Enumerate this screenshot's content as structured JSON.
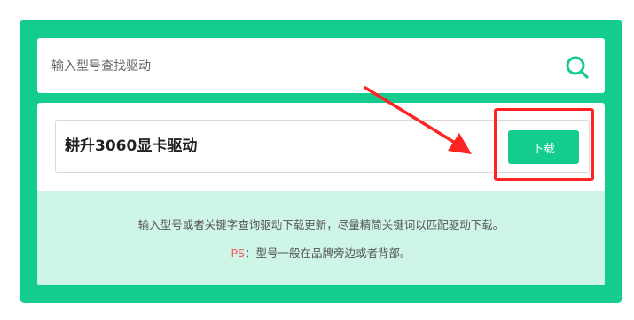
{
  "search": {
    "placeholder": "输入型号查找驱动",
    "value": "",
    "icon": "search-icon"
  },
  "result": {
    "title": "耕升3060显卡驱动",
    "download_label": "下载"
  },
  "hint": {
    "line1": "输入型号或者关键字查询驱动下载更新，尽量精简关键词以匹配驱动下载。",
    "ps_label": "PS",
    "ps_separator": "：",
    "ps_text": "型号一般在品牌旁边或者背部。"
  },
  "colors": {
    "brand_green": "#14cc8f",
    "hint_background": "#cff5e7",
    "annotation_red": "#ff2424",
    "ps_red": "#ff5555"
  }
}
